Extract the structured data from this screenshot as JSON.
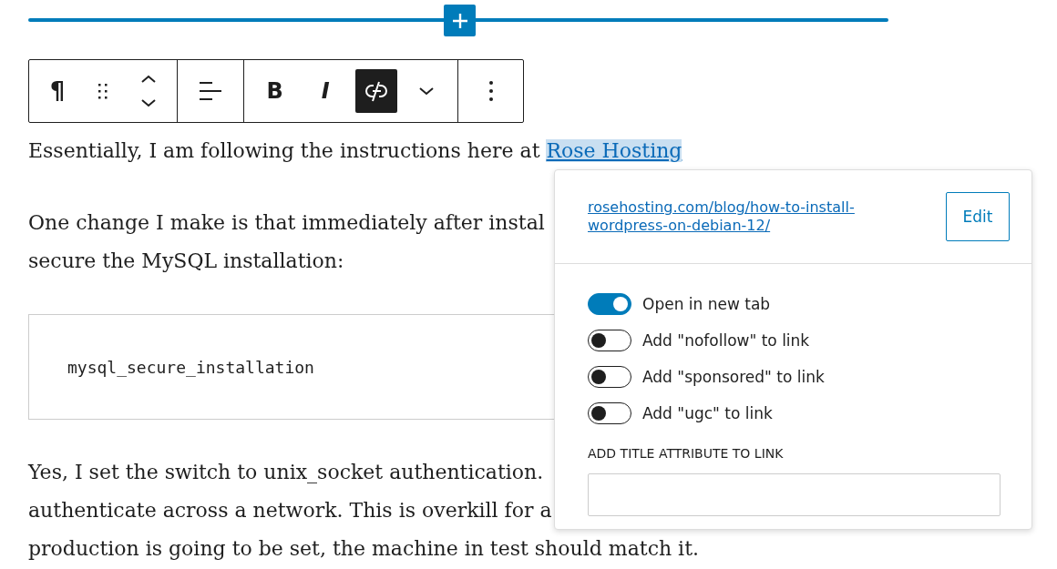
{
  "toolbar": {
    "groups": [
      [
        {
          "kind": "paragraph",
          "label": "¶",
          "pressed": false
        },
        {
          "kind": "drag",
          "pressed": false
        },
        {
          "kind": "move",
          "pressed": false
        }
      ],
      [
        {
          "kind": "align",
          "pressed": false
        }
      ],
      [
        {
          "kind": "bold",
          "label": "B",
          "pressed": false
        },
        {
          "kind": "italic",
          "label": "I",
          "pressed": false
        },
        {
          "kind": "link",
          "pressed": true
        },
        {
          "kind": "more",
          "pressed": false
        }
      ],
      [
        {
          "kind": "options",
          "pressed": false
        }
      ]
    ]
  },
  "paragraph_1": {
    "text": "Essentially, I am following the instructions here at ",
    "link": {
      "text": "Rose Hosting",
      "selected": true
    }
  },
  "paragraph_2": {
    "lines": [
      "One change I make is that immediately after instal",
      "secure the MySQL installation:"
    ]
  },
  "code_block": {
    "text": "mysql_secure_installation"
  },
  "paragraph_3": {
    "lines": [
      "Yes, I set the switch to unix_socket authentication.",
      "authenticate across a network. This is overkill for a",
      "production is going to be set, the machine in test should match it."
    ]
  },
  "link_popover": {
    "url_lines": [
      "rosehosting.com/blog/how-to-install-",
      "wordpress-on-debian-12/"
    ],
    "edit_button": "Edit",
    "toggles": [
      {
        "label": "Open in new tab",
        "on": true
      },
      {
        "label": "Add \"nofollow\" to link",
        "on": false
      },
      {
        "label": "Add \"sponsored\" to link",
        "on": false
      },
      {
        "label": "Add \"ugc\" to link",
        "on": false
      }
    ],
    "title_field": {
      "label": "ADD TITLE ATTRIBUTE TO LINK"
    }
  }
}
